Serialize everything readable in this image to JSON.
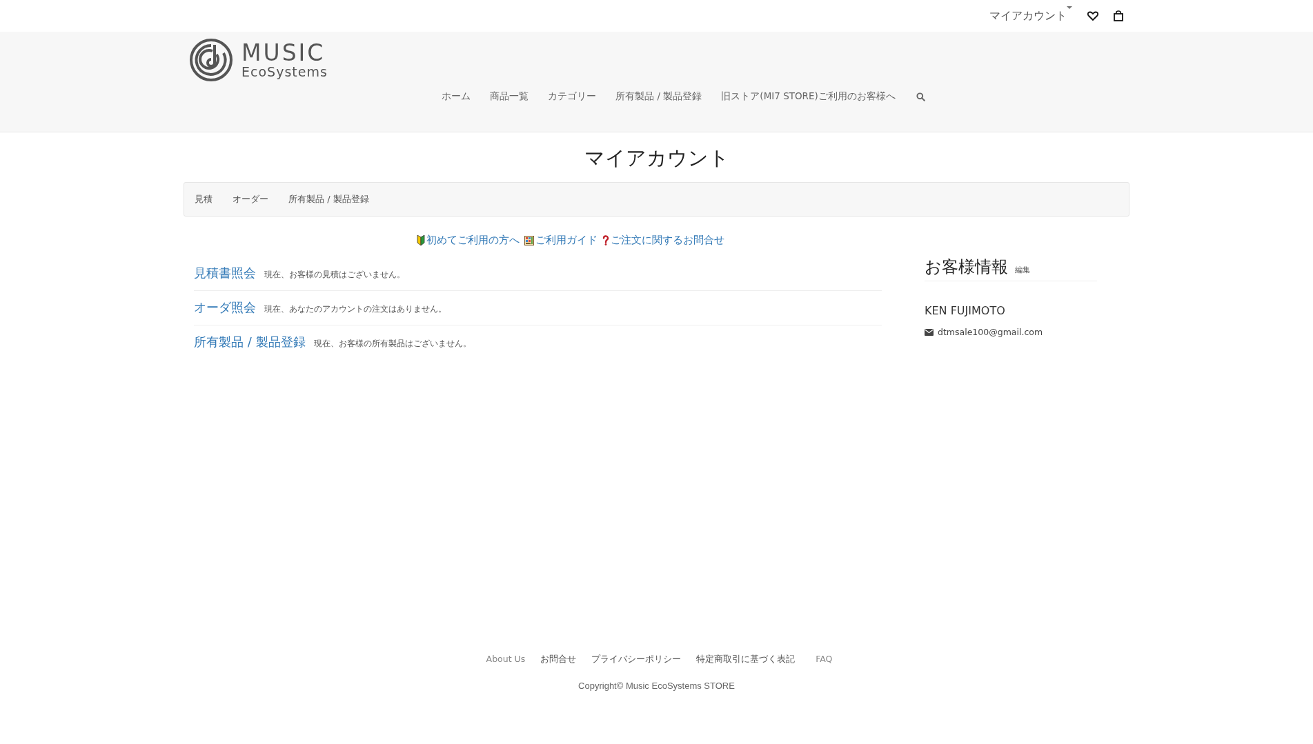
{
  "top_bar": {
    "account_menu": "マイアカウント"
  },
  "logo": {
    "line_1": "MUSIC",
    "line_2": "EcoSystems"
  },
  "nav": [
    "ホーム",
    "商品一覧",
    "カテゴリー",
    "所有製品 / 製品登録",
    "旧ストア(MI7 STORE)ご利用のお客様へ"
  ],
  "page_title": "マイアカウント",
  "tabs": [
    "見積",
    "オーダー",
    "所有製品 / 製品登録"
  ],
  "help_links": [
    {
      "kind": "beginner",
      "label": "初めてご利用の方へ"
    },
    {
      "kind": "guide",
      "label": "ご利用ガイド"
    },
    {
      "kind": "question",
      "label": "ご注文に関するお問合せ"
    }
  ],
  "sections": [
    {
      "title": "見積書照会",
      "note": "現在、お客様の見積はございません。"
    },
    {
      "title": "オーダ照会",
      "note": "現在、あなたのアカウントの注文はありません。"
    },
    {
      "title": "所有製品 / 製品登録",
      "note": "現在、お客様の所有製品はございません。"
    }
  ],
  "customer": {
    "heading": "お客様情報",
    "edit": "編集",
    "name": "KEN FUJIMOTO",
    "email": "dtmsale100@gmail.com"
  },
  "footer": {
    "links": [
      "About Us",
      "お問合せ",
      "プライバシーポリシー",
      "特定商取引に基づく表記",
      "FAQ"
    ],
    "copyright": "Copyright© Music EcoSystems STORE"
  }
}
